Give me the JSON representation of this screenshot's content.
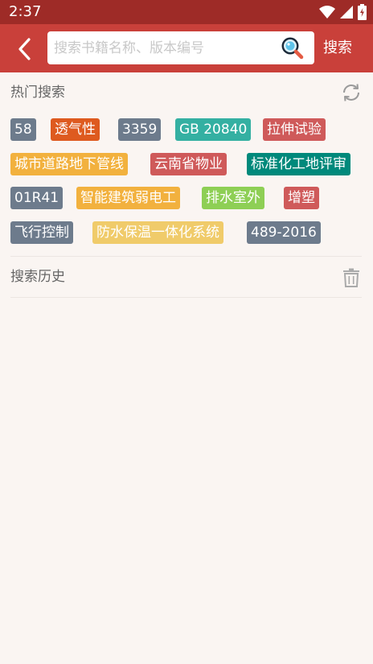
{
  "status": {
    "time": "2:37"
  },
  "header": {
    "search_placeholder": "搜索书籍名称、版本编号",
    "search_value": "",
    "search_button_label": "搜索"
  },
  "hot": {
    "title": "热门搜索",
    "rows": [
      [
        {
          "label": "58",
          "color": "#6d7b8c"
        },
        {
          "label": "透气性",
          "color": "#de5a1f"
        },
        {
          "label": "3359",
          "color": "#6d7b8c"
        },
        {
          "label": "GB 20840",
          "color": "#34b0a2"
        },
        {
          "label": "拉伸试验",
          "color": "#cf5a5a"
        }
      ],
      [
        {
          "label": "城市道路地下管线",
          "color": "#f2b13e"
        },
        {
          "label": "云南省物业",
          "color": "#cf5a5a"
        },
        {
          "label": "标准化工地评审",
          "color": "#00897b"
        }
      ],
      [
        {
          "label": "01R41",
          "color": "#6d7b8c"
        },
        {
          "label": "智能建筑弱电工",
          "color": "#f2b13e"
        },
        {
          "label": "排水室外",
          "color": "#8ecf55"
        },
        {
          "label": "增塑",
          "color": "#cf5a5a"
        }
      ],
      [
        {
          "label": "飞行控制",
          "color": "#6d7b8c"
        },
        {
          "label": "防水保温一体化系统",
          "color": "#f0cb6a"
        },
        {
          "label": "489-2016",
          "color": "#6d7b8c"
        }
      ]
    ]
  },
  "history": {
    "title": "搜索历史"
  }
}
